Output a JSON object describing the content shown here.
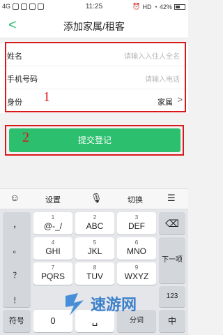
{
  "status_bar": {
    "left": "4G",
    "time": "11:25",
    "battery": "42%",
    "hd": "HD"
  },
  "nav": {
    "title": "添加家属/租客"
  },
  "form": {
    "name_label": "姓名",
    "name_placeholder": "请输入入住人全名",
    "phone_label": "手机号码",
    "phone_placeholder": "请输入电话",
    "identity_label": "身份",
    "identity_value": "家属"
  },
  "annotations": {
    "one": "1",
    "two": "2"
  },
  "submit_label": "提交登记",
  "keyboard": {
    "toolbar": {
      "settings": "设置",
      "switch": "切换"
    },
    "keys": {
      "k1": "1",
      "k1s": "@-_/",
      "k2": "2",
      "k2s": "ABC",
      "k3": "3",
      "k3s": "DEF",
      "k4": "4",
      "k4s": "GHI",
      "k5": "5",
      "k5s": "JKL",
      "k6": "6",
      "k6s": "MNO",
      "k7": "7",
      "k7s": "PQRS",
      "k8": "8",
      "k8s": "TUV",
      "k9": "9",
      "k9s": "WXYZ",
      "k0": "0",
      "symbol": "符号",
      "segment": "分词",
      "next": "下一项",
      "num123": "123",
      "p1": "，",
      "p2": "。",
      "p3": "？",
      "p4": "！"
    }
  },
  "watermark": {
    "text": "速游网",
    "sub": "www.sygame.com"
  }
}
